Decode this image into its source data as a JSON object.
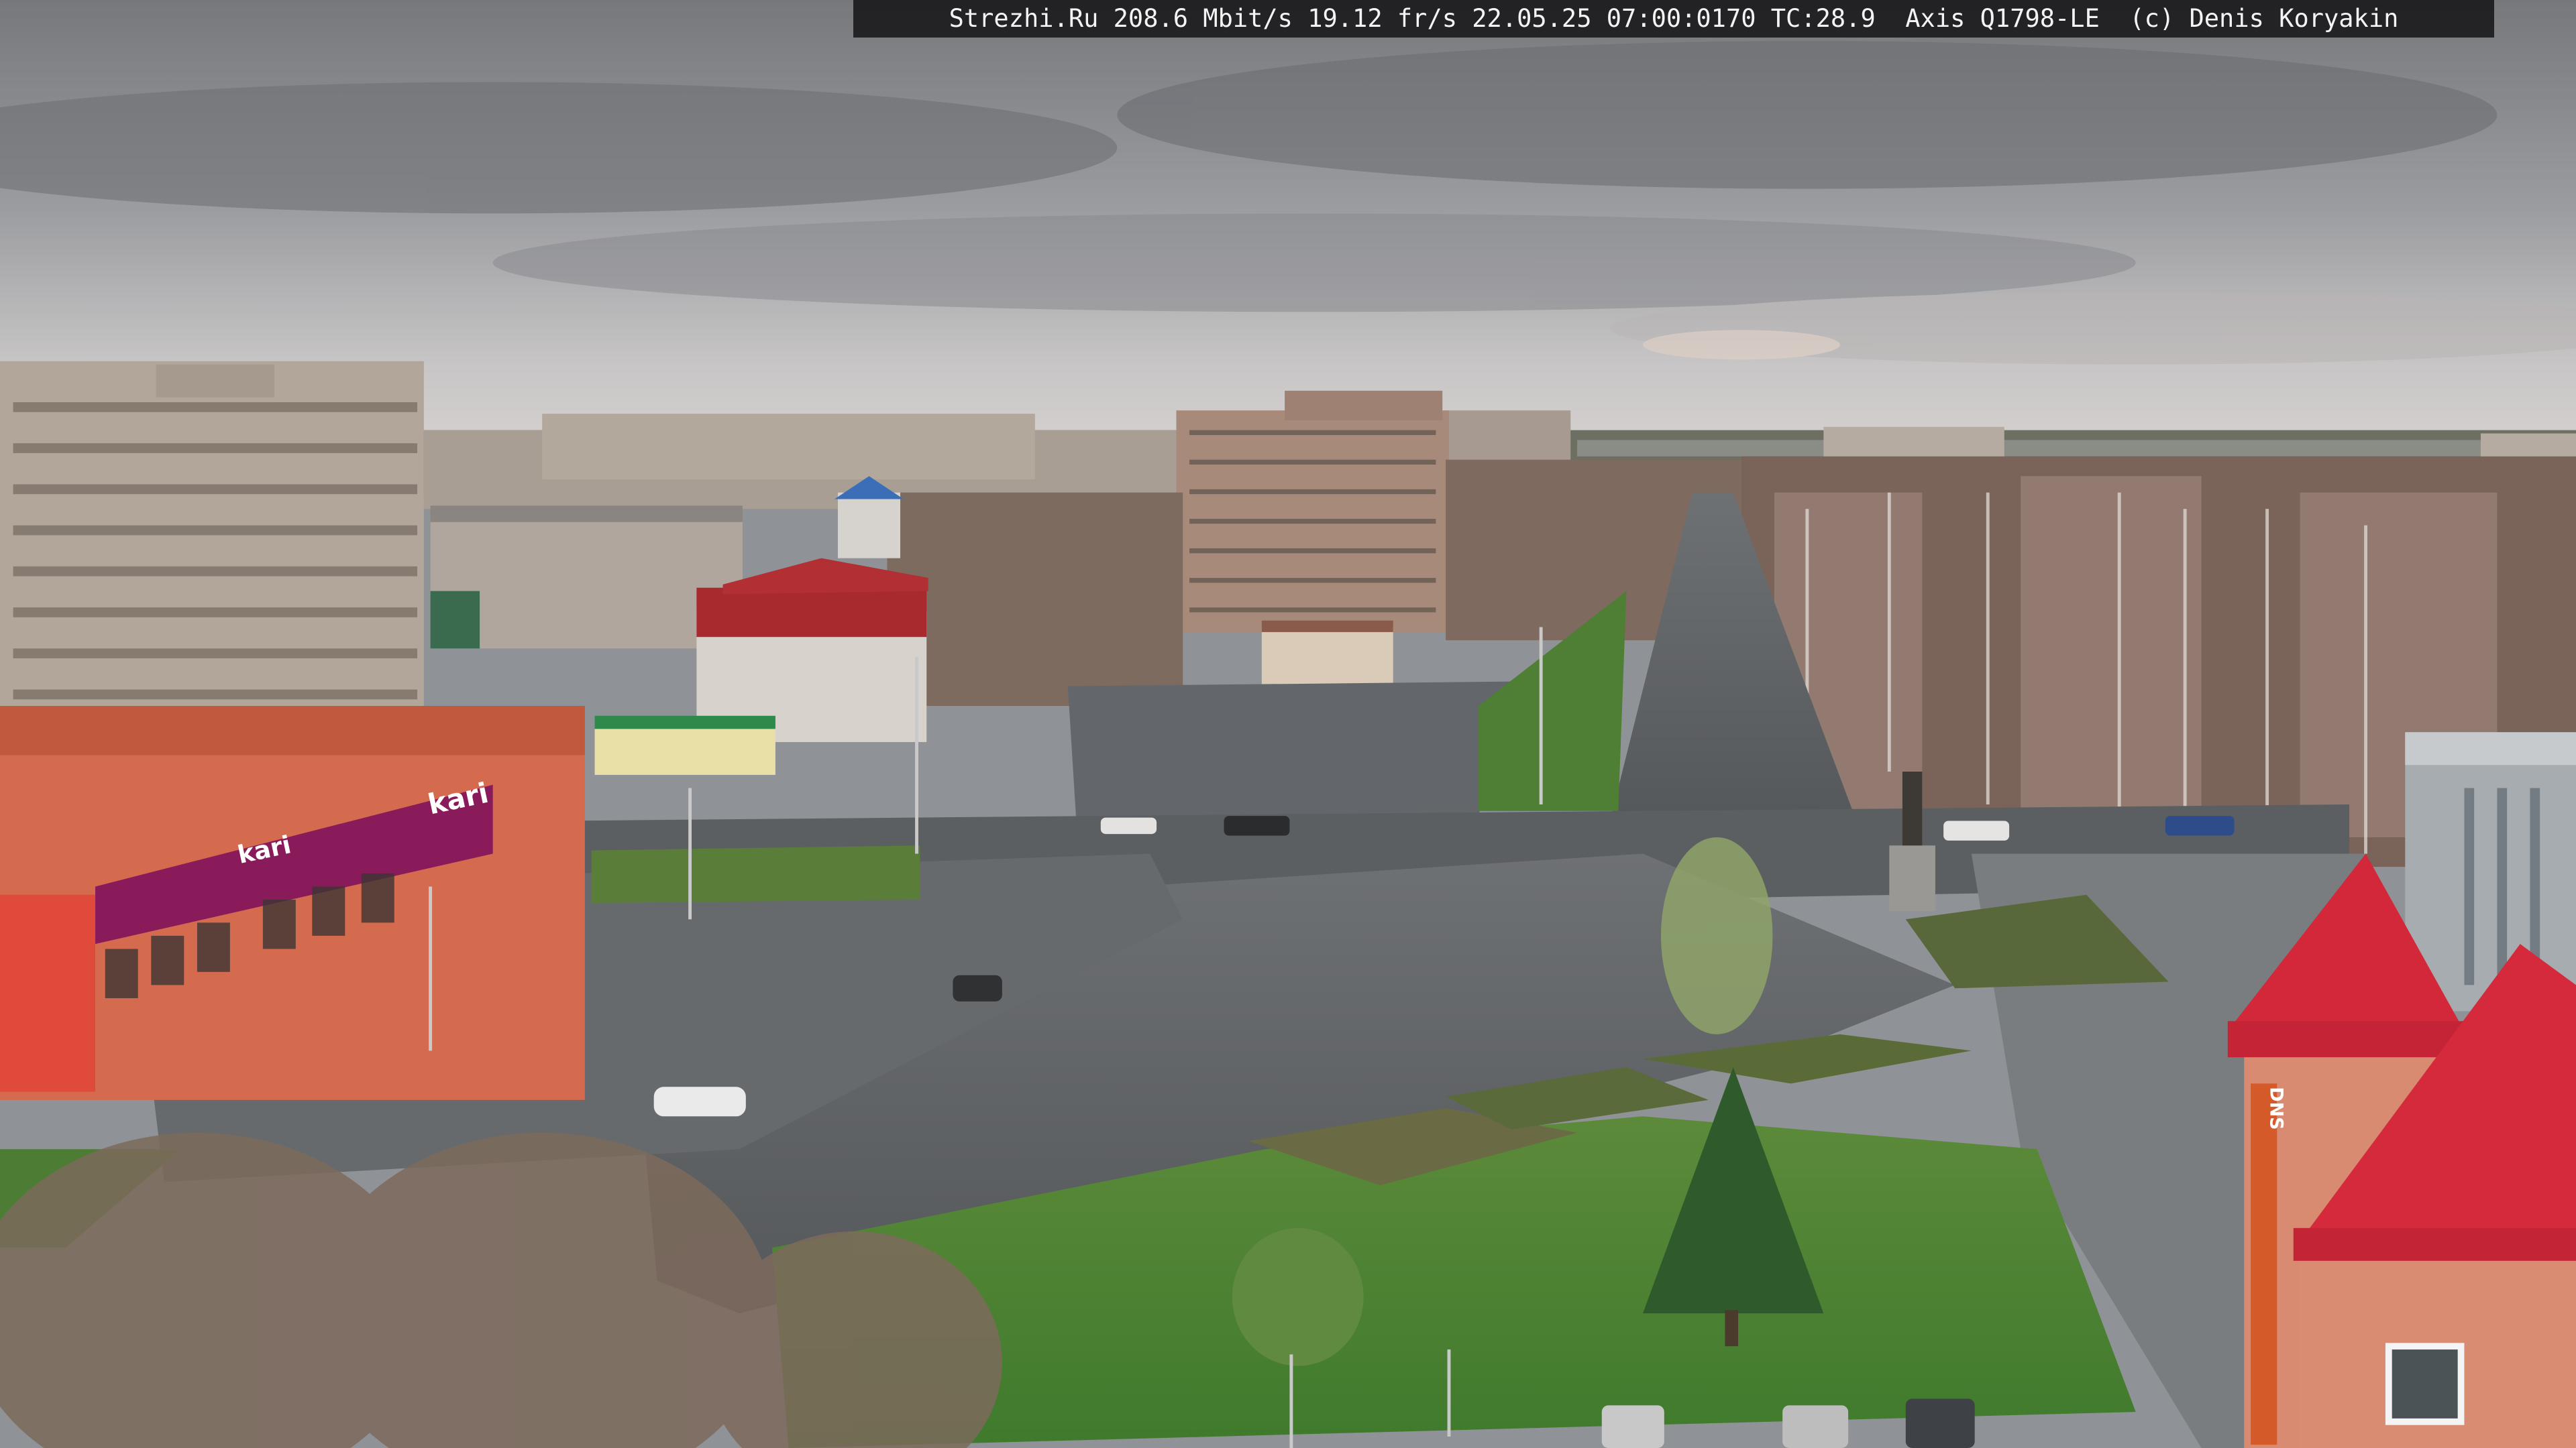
{
  "overlay": {
    "text": "Strezhi.Ru 208.6 Mbit/s 19.12 fr/s 22.05.25 07:00:0170 TC:28.9  Axis Q1798-LE  (c) Denis Koryakin"
  },
  "signage": {
    "store_brand": "kari",
    "store_brand_second": "kari",
    "vertical_sign": "DNS"
  }
}
